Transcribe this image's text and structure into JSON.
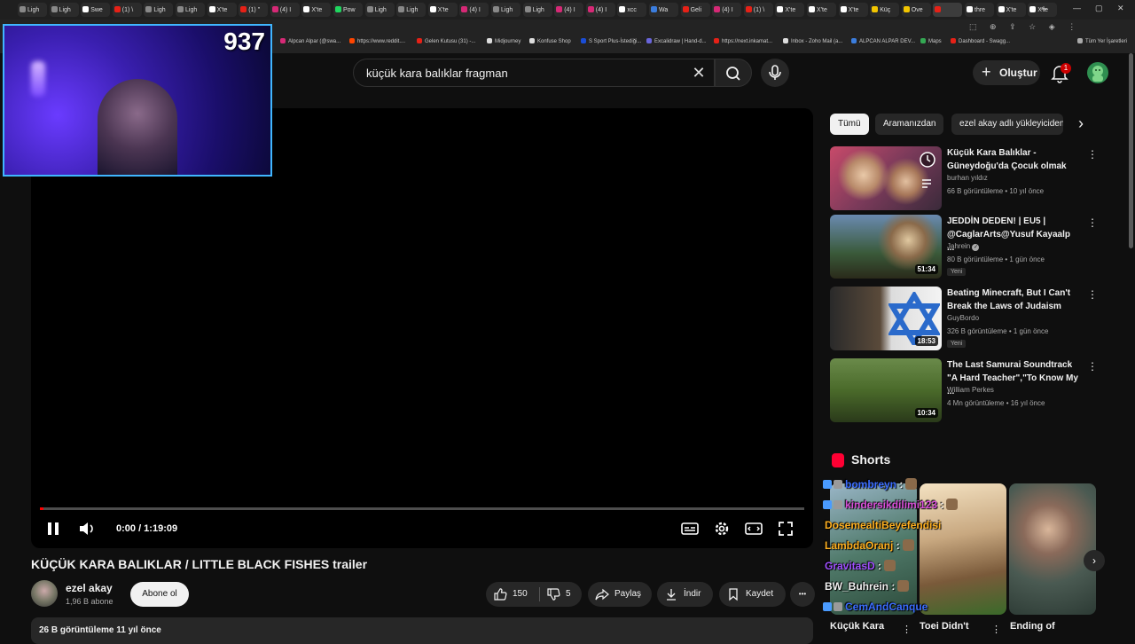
{
  "browser": {
    "tabs": [
      {
        "label": "Ligh",
        "color": "#888888"
      },
      {
        "label": "Ligh",
        "color": "#888888"
      },
      {
        "label": "Swe",
        "color": "#ffffff"
      },
      {
        "label": "(1) \\",
        "color": "#e62117"
      },
      {
        "label": "Ligh",
        "color": "#888888"
      },
      {
        "label": "Ligh",
        "color": "#888888"
      },
      {
        "label": "X'te",
        "color": "#ffffff"
      },
      {
        "label": "(1) \"",
        "color": "#e62117"
      },
      {
        "label": "(4) I",
        "color": "#d62976"
      },
      {
        "label": "X'te",
        "color": "#ffffff"
      },
      {
        "label": "Pow",
        "color": "#1fd65f"
      },
      {
        "label": "Ligh",
        "color": "#888888"
      },
      {
        "label": "Ligh",
        "color": "#888888"
      },
      {
        "label": "X'te",
        "color": "#ffffff"
      },
      {
        "label": "(4) I",
        "color": "#d62976"
      },
      {
        "label": "Ligh",
        "color": "#888888"
      },
      {
        "label": "Ligh",
        "color": "#888888"
      },
      {
        "label": "(4) I",
        "color": "#d62976"
      },
      {
        "label": "(4) I",
        "color": "#d62976"
      },
      {
        "label": "xcc",
        "color": "#ffffff"
      },
      {
        "label": "Wa",
        "color": "#3b7ddd"
      },
      {
        "label": "Geli",
        "color": "#e62117"
      },
      {
        "label": "(4) I",
        "color": "#d62976"
      },
      {
        "label": "(1) \\",
        "color": "#e62117"
      },
      {
        "label": "X'te",
        "color": "#ffffff"
      },
      {
        "label": "X'te",
        "color": "#ffffff"
      },
      {
        "label": "X'te",
        "color": "#ffffff"
      },
      {
        "label": "Küç",
        "color": "#f2c500"
      },
      {
        "label": "Ove",
        "color": "#f2c500"
      },
      {
        "label": "",
        "color": "#e62117"
      },
      {
        "label": "thre",
        "color": "#ffffff"
      },
      {
        "label": "X'te",
        "color": "#ffffff"
      },
      {
        "label": "X'te",
        "color": "#ffffff"
      }
    ],
    "active_tab_index": 29,
    "new_tab_glyph": "+",
    "bookmarks": [
      {
        "label": "Alpcan Alpar (@swa...",
        "color": "#d62976"
      },
      {
        "label": "https://www.reddit....",
        "color": "#ff4500"
      },
      {
        "label": "Gelen Kutusu (31) -...",
        "color": "#e62117"
      },
      {
        "label": "Midjourney",
        "color": "#dddddd"
      },
      {
        "label": "Konfuse Shop",
        "color": "#dddddd"
      },
      {
        "label": "S Sport Plus-İstediği...",
        "color": "#1a4dd6"
      },
      {
        "label": "Excalidraw | Hand-d...",
        "color": "#6965db"
      },
      {
        "label": "https://next.inkamat...",
        "color": "#e62117"
      },
      {
        "label": "Inbox - Zoho Mail (a...",
        "color": "#dddddd"
      },
      {
        "label": "ALPCAN ALPAR DEV...",
        "color": "#3b7ddd"
      },
      {
        "label": "Maps",
        "color": "#34a853"
      },
      {
        "label": "Dashboard - Swagg...",
        "color": "#e62117"
      }
    ],
    "all_bookmarks": "Tüm Yer İşaretleri"
  },
  "webcam": {
    "viewer_count": "937"
  },
  "header": {
    "search_value": "küçük kara balıklar fragman",
    "clear_glyph": "✕",
    "create_label": "Oluştur",
    "create_glyph": "+",
    "notif_count": "1"
  },
  "player": {
    "time": "0:00 / 1:19:09",
    "progress_fraction": 0.005
  },
  "video": {
    "title": "KÜÇÜK KARA BALIKLAR / LITTLE BLACK FISHES trailer",
    "channel": "ezel akay",
    "subs": "1,96 B abone",
    "subscribe": "Abone ol",
    "likes": "150",
    "dislikes": "5",
    "share": "Paylaş",
    "download": "İndir",
    "save": "Kaydet",
    "more_glyph": "•••",
    "stats": "26 B görüntüleme  11 yıl önce"
  },
  "chips": [
    "Tümü",
    "Aramanızdan",
    "ezel akay adlı yükleyiciden"
  ],
  "chips_next_glyph": "›",
  "recommendations": [
    {
      "title": "Küçük Kara Balıklar - Güneydoğu'da Çocuk olmak",
      "channel": "burhan yıldız",
      "meta": "66 B görüntüleme • 10 yıl önce",
      "duration": "",
      "badge": "",
      "verified": false,
      "thumb": "kids"
    },
    {
      "title": "JEDDİN DEDEN! | EU5 | @CaglarArts@Yusuf Kayaalp ...",
      "channel": "Jahrein",
      "meta": "80 B görüntüleme • 1 gün önce",
      "duration": "51:34",
      "badge": "Yeni",
      "verified": true,
      "thumb": "europa"
    },
    {
      "title": "Beating Minecraft, But I Can't Break the Laws of Judaism",
      "channel": "GuyBordo",
      "meta": "326 B görüntüleme • 1 gün önce",
      "duration": "18:53",
      "badge": "Yeni",
      "verified": false,
      "thumb": "minecraft"
    },
    {
      "title": "The Last Samurai Soundtrack \"A Hard Teacher\",\"To Know My ...",
      "channel": "William Perkes",
      "meta": "4 Mn görüntüleme • 16 yıl önce",
      "duration": "10:34",
      "badge": "",
      "verified": false,
      "thumb": "samurai"
    }
  ],
  "rec_dots_glyph": "⋮",
  "shorts": {
    "title": "Shorts",
    "items": [
      {
        "title": "Küçük Kara"
      },
      {
        "title": "Toei Didn't"
      },
      {
        "title": "Ending of"
      }
    ],
    "next_glyph": "›"
  },
  "chat": [
    {
      "user": "bombreyn",
      "sep": " :",
      "color": "#3b6dff"
    },
    {
      "user": "kindersikdilimi123",
      "sep": " :",
      "color": "#d94fd9"
    },
    {
      "user": "DosemealtiBeyefendisi",
      "sep": "",
      "color": "#ffb020"
    },
    {
      "user": "LambdaOranj",
      "sep": " :",
      "color": "#ffb020"
    },
    {
      "user": "GravitasD",
      "sep": " :",
      "color": "#a050ff"
    },
    {
      "user": "BW_Buhrein",
      "sep": " :",
      "color": "#f1f1f1"
    },
    {
      "user": "CemAndCanque",
      "sep": "",
      "color": "#3b6dff"
    }
  ],
  "icons": {
    "search": "search-icon",
    "mic": "microphone-icon",
    "bell": "bell-icon",
    "pause": "pause-icon",
    "volume": "volume-icon",
    "subtitles": "subtitles-icon",
    "settings": "gear-icon",
    "theater": "theater-icon",
    "fullscreen": "fullscreen-icon",
    "like": "thumbs-up-icon",
    "dislike": "thumbs-down-icon",
    "share": "share-icon",
    "download": "download-icon",
    "save": "bookmark-icon",
    "shorts": "shorts-icon",
    "verified": "verified-icon",
    "watch_later": "clock-icon"
  },
  "colors": {
    "accent_red": "#ff0000",
    "webcam_border": "#40b6ff",
    "background": "#0f0f0f"
  }
}
